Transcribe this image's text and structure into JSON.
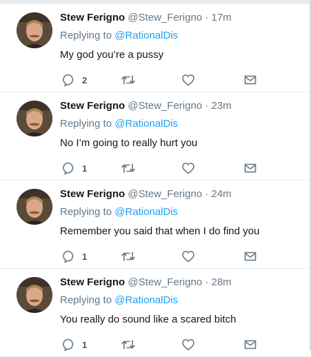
{
  "tweets": [
    {
      "name": "Stew Ferigno",
      "handle": "@Stew_Ferigno",
      "separator": "·",
      "time": "17m",
      "reply_prefix": "Replying to",
      "reply_to": "@RationalDis",
      "text": "My god you’re a pussy",
      "reply_count": "2"
    },
    {
      "name": "Stew Ferigno",
      "handle": "@Stew_Ferigno",
      "separator": "·",
      "time": "23m",
      "reply_prefix": "Replying to",
      "reply_to": "@RationalDis",
      "text": "No I’m going to really hurt you",
      "reply_count": "1"
    },
    {
      "name": "Stew Ferigno",
      "handle": "@Stew_Ferigno",
      "separator": "·",
      "time": "24m",
      "reply_prefix": "Replying to",
      "reply_to": "@RationalDis",
      "text": "Remember you said that when I do find you",
      "reply_count": "1"
    },
    {
      "name": "Stew Ferigno",
      "handle": "@Stew_Ferigno",
      "separator": "·",
      "time": "28m",
      "reply_prefix": "Replying to",
      "reply_to": "@RationalDis",
      "text": "You really do sound like a scared bitch",
      "reply_count": "1"
    }
  ],
  "icons": {
    "reply": "reply-icon",
    "retweet": "retweet-icon",
    "like": "heart-icon",
    "message": "envelope-icon"
  },
  "colors": {
    "link": "#1da1f2",
    "muted": "#657786",
    "text": "#14171a",
    "divider": "#e6ecf0"
  }
}
